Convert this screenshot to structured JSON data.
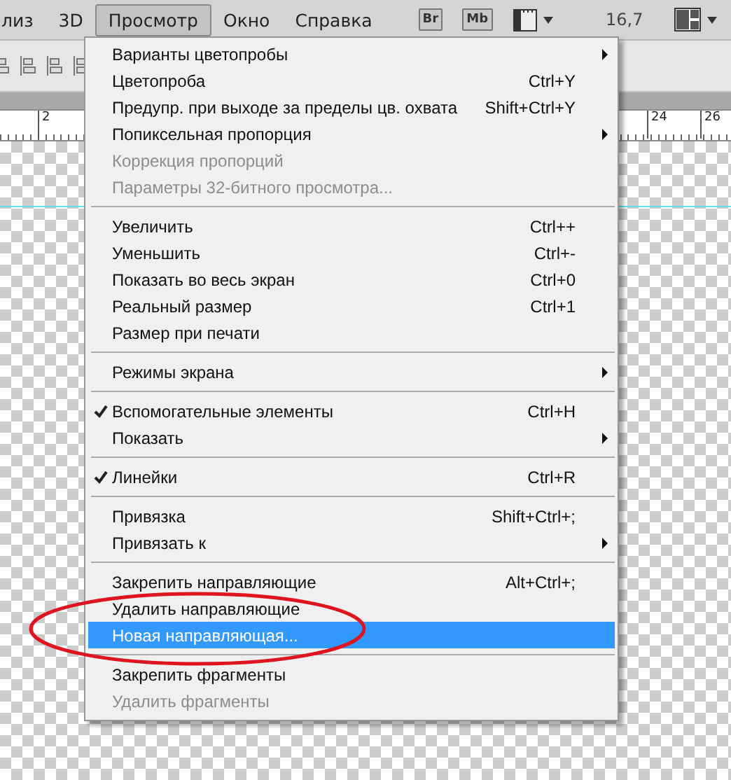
{
  "menubar": {
    "items": [
      {
        "label": "лиз",
        "selected": false
      },
      {
        "label": "3D",
        "selected": false
      },
      {
        "label": "Просмотр",
        "selected": true
      },
      {
        "label": "Окно",
        "selected": false
      },
      {
        "label": "Справка",
        "selected": false
      }
    ],
    "apps": [
      "Br",
      "Mb"
    ],
    "zoom": "16,7"
  },
  "ruler": {
    "labels": [
      "2",
      "24",
      "26"
    ]
  },
  "menu": {
    "groups": [
      [
        {
          "label": "Варианты цветопробы",
          "submenu": true,
          "checked": false,
          "disabled": false,
          "selected": false
        },
        {
          "label": "Цветопроба",
          "shortcut": "Ctrl+Y",
          "submenu": false,
          "checked": false,
          "disabled": false,
          "selected": false
        },
        {
          "label": "Предупр. при выходе за пределы цв. охвата",
          "shortcut": "Shift+Ctrl+Y",
          "submenu": false,
          "checked": false,
          "disabled": false,
          "selected": false
        },
        {
          "label": "Попиксельная пропорция",
          "submenu": true,
          "checked": false,
          "disabled": false,
          "selected": false
        },
        {
          "label": "Коррекция пропорций",
          "submenu": false,
          "checked": false,
          "disabled": true,
          "selected": false
        },
        {
          "label": "Параметры 32-битного просмотра...",
          "submenu": false,
          "checked": false,
          "disabled": true,
          "selected": false
        }
      ],
      [
        {
          "label": "Увеличить",
          "shortcut": "Ctrl++",
          "submenu": false,
          "checked": false,
          "disabled": false,
          "selected": false
        },
        {
          "label": "Уменьшить",
          "shortcut": "Ctrl+-",
          "submenu": false,
          "checked": false,
          "disabled": false,
          "selected": false
        },
        {
          "label": "Показать во весь экран",
          "shortcut": "Ctrl+0",
          "submenu": false,
          "checked": false,
          "disabled": false,
          "selected": false
        },
        {
          "label": "Реальный размер",
          "shortcut": "Ctrl+1",
          "submenu": false,
          "checked": false,
          "disabled": false,
          "selected": false
        },
        {
          "label": "Размер при печати",
          "submenu": false,
          "checked": false,
          "disabled": false,
          "selected": false
        }
      ],
      [
        {
          "label": "Режимы экрана",
          "submenu": true,
          "checked": false,
          "disabled": false,
          "selected": false
        }
      ],
      [
        {
          "label": "Вспомогательные элементы",
          "shortcut": "Ctrl+H",
          "submenu": false,
          "checked": true,
          "disabled": false,
          "selected": false
        },
        {
          "label": "Показать",
          "submenu": true,
          "checked": false,
          "disabled": false,
          "selected": false
        }
      ],
      [
        {
          "label": "Линейки",
          "shortcut": "Ctrl+R",
          "submenu": false,
          "checked": true,
          "disabled": false,
          "selected": false
        }
      ],
      [
        {
          "label": "Привязка",
          "shortcut": "Shift+Ctrl+;",
          "submenu": false,
          "checked": false,
          "disabled": false,
          "selected": false
        },
        {
          "label": "Привязать к",
          "submenu": true,
          "checked": false,
          "disabled": false,
          "selected": false
        }
      ],
      [
        {
          "label": "Закрепить направляющие",
          "shortcut": "Alt+Ctrl+;",
          "submenu": false,
          "checked": false,
          "disabled": false,
          "selected": false
        },
        {
          "label": "Удалить направляющие",
          "submenu": false,
          "checked": false,
          "disabled": false,
          "selected": false
        },
        {
          "label": "Новая направляющая...",
          "submenu": false,
          "checked": false,
          "disabled": false,
          "selected": true
        }
      ],
      [
        {
          "label": "Закрепить фрагменты",
          "submenu": false,
          "checked": false,
          "disabled": false,
          "selected": false
        },
        {
          "label": "Удалить фрагменты",
          "submenu": false,
          "checked": false,
          "disabled": true,
          "selected": false
        }
      ]
    ]
  }
}
